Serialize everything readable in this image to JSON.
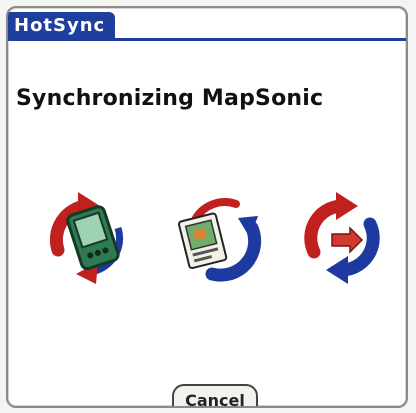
{
  "window": {
    "title": "HotSync",
    "accent_color": "#1f3f9d"
  },
  "dialog": {
    "heading": "Synchronizing MapSonic"
  },
  "sync_icons": [
    {
      "icon": "handheld-sync-icon",
      "arrow_color": "#c0201e",
      "accent_color": "#1e3aa0"
    },
    {
      "icon": "document-sync-icon",
      "arrow_color": "#c0201e",
      "accent_color": "#1e3aa0"
    },
    {
      "icon": "sync-arrows-icon",
      "arrow_color": "#c0201e",
      "accent_color": "#1e3aa0"
    }
  ],
  "buttons": {
    "cancel_label": "Cancel"
  }
}
